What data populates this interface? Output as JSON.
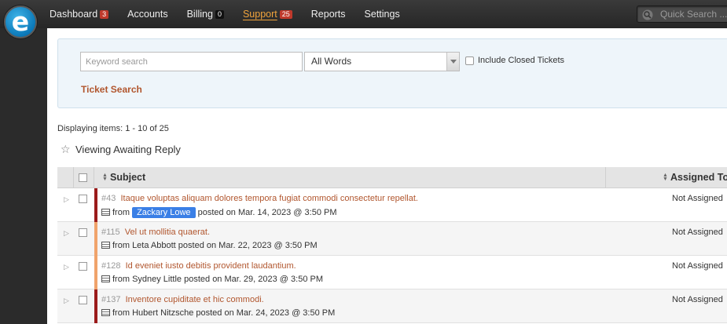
{
  "topbar": {
    "logo_letter": "e",
    "nav": [
      {
        "label": "Dashboard",
        "badge": "3",
        "badge_style": "red",
        "active": false
      },
      {
        "label": "Accounts",
        "badge": "",
        "active": false
      },
      {
        "label": "Billing",
        "badge": "0",
        "badge_style": "dark",
        "active": false
      },
      {
        "label": "Support",
        "badge": "25",
        "badge_style": "red",
        "active": true
      },
      {
        "label": "Reports",
        "badge": "",
        "active": false
      },
      {
        "label": "Settings",
        "badge": "",
        "active": false
      }
    ],
    "quick_search_placeholder": "Quick Search ..."
  },
  "search": {
    "keyword_placeholder": "Keyword search",
    "match_mode": "All Words",
    "include_closed_label": "Include Closed Tickets",
    "include_closed_checked": false,
    "submit_label": "Ticket Search"
  },
  "listing": {
    "displaying": "Displaying items: 1 - 10 of 25",
    "viewing": "Viewing  Awaiting Reply"
  },
  "table": {
    "columns": {
      "subject": "Subject",
      "assigned": "Assigned To"
    },
    "rows": [
      {
        "id": "#43",
        "subject": "Itaque voluptas aliquam dolores tempora fugiat commodi consectetur repellat.",
        "from_prefix": "from",
        "from": "Zackary Lowe",
        "from_highlight": true,
        "posted": "posted on Mar. 14, 2023 @ 3:50 PM",
        "assigned": "Not Assigned",
        "priority_color": "#9b1b1b"
      },
      {
        "id": "#115",
        "subject": "Vel ut mollitia quaerat.",
        "from_prefix": "from",
        "from": "Leta Abbott",
        "from_highlight": false,
        "posted": "posted on Mar. 22, 2023 @ 3:50 PM",
        "assigned": "Not Assigned",
        "priority_color": "#f0a36b"
      },
      {
        "id": "#128",
        "subject": "Id eveniet iusto debitis provident laudantium.",
        "from_prefix": "from",
        "from": "Sydney Little",
        "from_highlight": false,
        "posted": "posted on Mar. 29, 2023 @ 3:50 PM",
        "assigned": "Not Assigned",
        "priority_color": "#f0a36b"
      },
      {
        "id": "#137",
        "subject": "Inventore cupiditate et hic commodi.",
        "from_prefix": "from",
        "from": "Hubert Nitzsche",
        "from_highlight": false,
        "posted": "posted on Mar. 24, 2023 @ 3:50 PM",
        "assigned": "Not Assigned",
        "priority_color": "#9b1b1b"
      }
    ]
  },
  "icons": {
    "search": "magnifier-icon",
    "star": "star-icon",
    "expand": "expand-triangle-icon",
    "note": "ticket-note-icon"
  }
}
